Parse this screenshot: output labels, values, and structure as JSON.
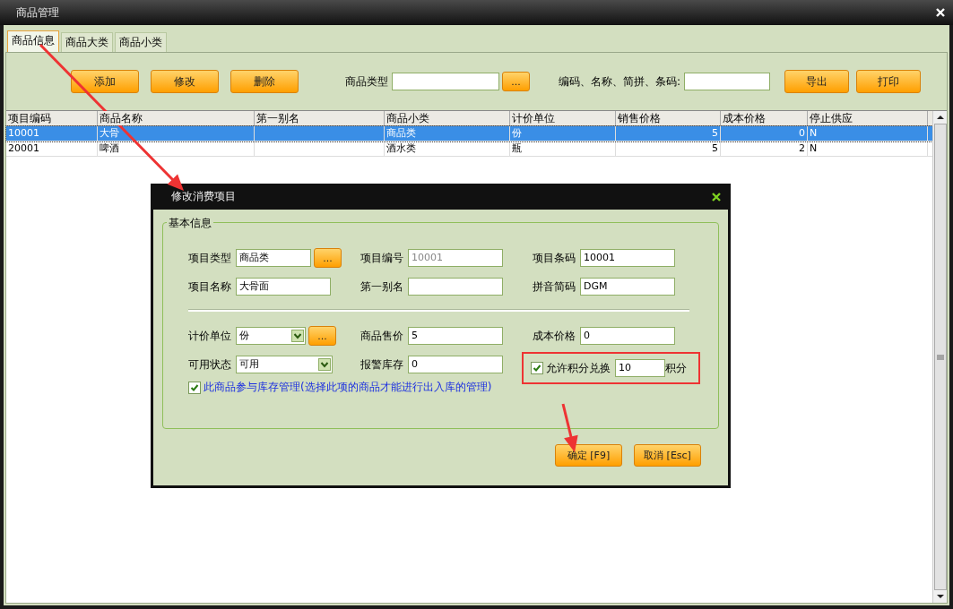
{
  "window": {
    "title": "商品管理"
  },
  "tabs": [
    {
      "label": "商品信息",
      "selected": true
    },
    {
      "label": "商品大类",
      "selected": false
    },
    {
      "label": "商品小类",
      "selected": false
    }
  ],
  "toolbar": {
    "actions": [
      "添加",
      "修改",
      "删除"
    ],
    "type_filter": {
      "label": "商品类型",
      "browse": "..."
    },
    "search": {
      "label": "编码、名称、简拼、条码:"
    },
    "outputs": [
      "导出",
      "打印"
    ]
  },
  "table": {
    "columns": [
      "项目编码",
      "商品名称",
      "第一别名",
      "商品小类",
      "计价单位",
      "销售价格",
      "成本价格",
      "停止供应"
    ],
    "rows": [
      {
        "selected": true,
        "cells": [
          "10001",
          "大骨",
          "",
          "商品类",
          "份",
          "5",
          "0",
          "N"
        ]
      },
      {
        "selected": false,
        "cells": [
          "20001",
          "啤酒",
          "",
          "酒水类",
          "瓶",
          "5",
          "2",
          "N"
        ]
      }
    ]
  },
  "dialog": {
    "title": "修改消费项目",
    "group_title": "基本信息",
    "rows_top": [
      [
        {
          "kind": "browse",
          "label": "项目类型",
          "value": "商品类",
          "browse": "..."
        },
        {
          "kind": "readonly",
          "label": "项目编号",
          "value": "10001"
        },
        {
          "kind": "text",
          "label": "项目条码",
          "value": "10001"
        }
      ],
      [
        {
          "kind": "text",
          "label": "项目名称",
          "value": "大骨面"
        },
        {
          "kind": "text",
          "label": "第一别名"
        },
        {
          "kind": "text",
          "label": "拼音简码",
          "value": "DGM"
        }
      ]
    ],
    "rows_bottom": [
      [
        {
          "kind": "combo_browse",
          "label": "计价单位",
          "value": "份",
          "browse": "..."
        },
        {
          "kind": "text",
          "label": "商品售价",
          "value": "5"
        },
        {
          "kind": "text",
          "label": "成本价格",
          "value": "0"
        }
      ],
      [
        {
          "kind": "combo",
          "label": "可用状态",
          "value": "可用"
        },
        {
          "kind": "text",
          "label": "报警库存",
          "value": "0"
        },
        {
          "kind": "points",
          "label": "允许积分兑换",
          "checked": true,
          "value": "10",
          "unit": "积分",
          "highlighted": true
        }
      ]
    ],
    "stock_option": {
      "label": "此商品参与库存管理(选择此项的商品才能进行出入库的管理)",
      "checked": true
    },
    "buttons": [
      "确定 [F9]",
      "取消 [Esc]"
    ]
  }
}
